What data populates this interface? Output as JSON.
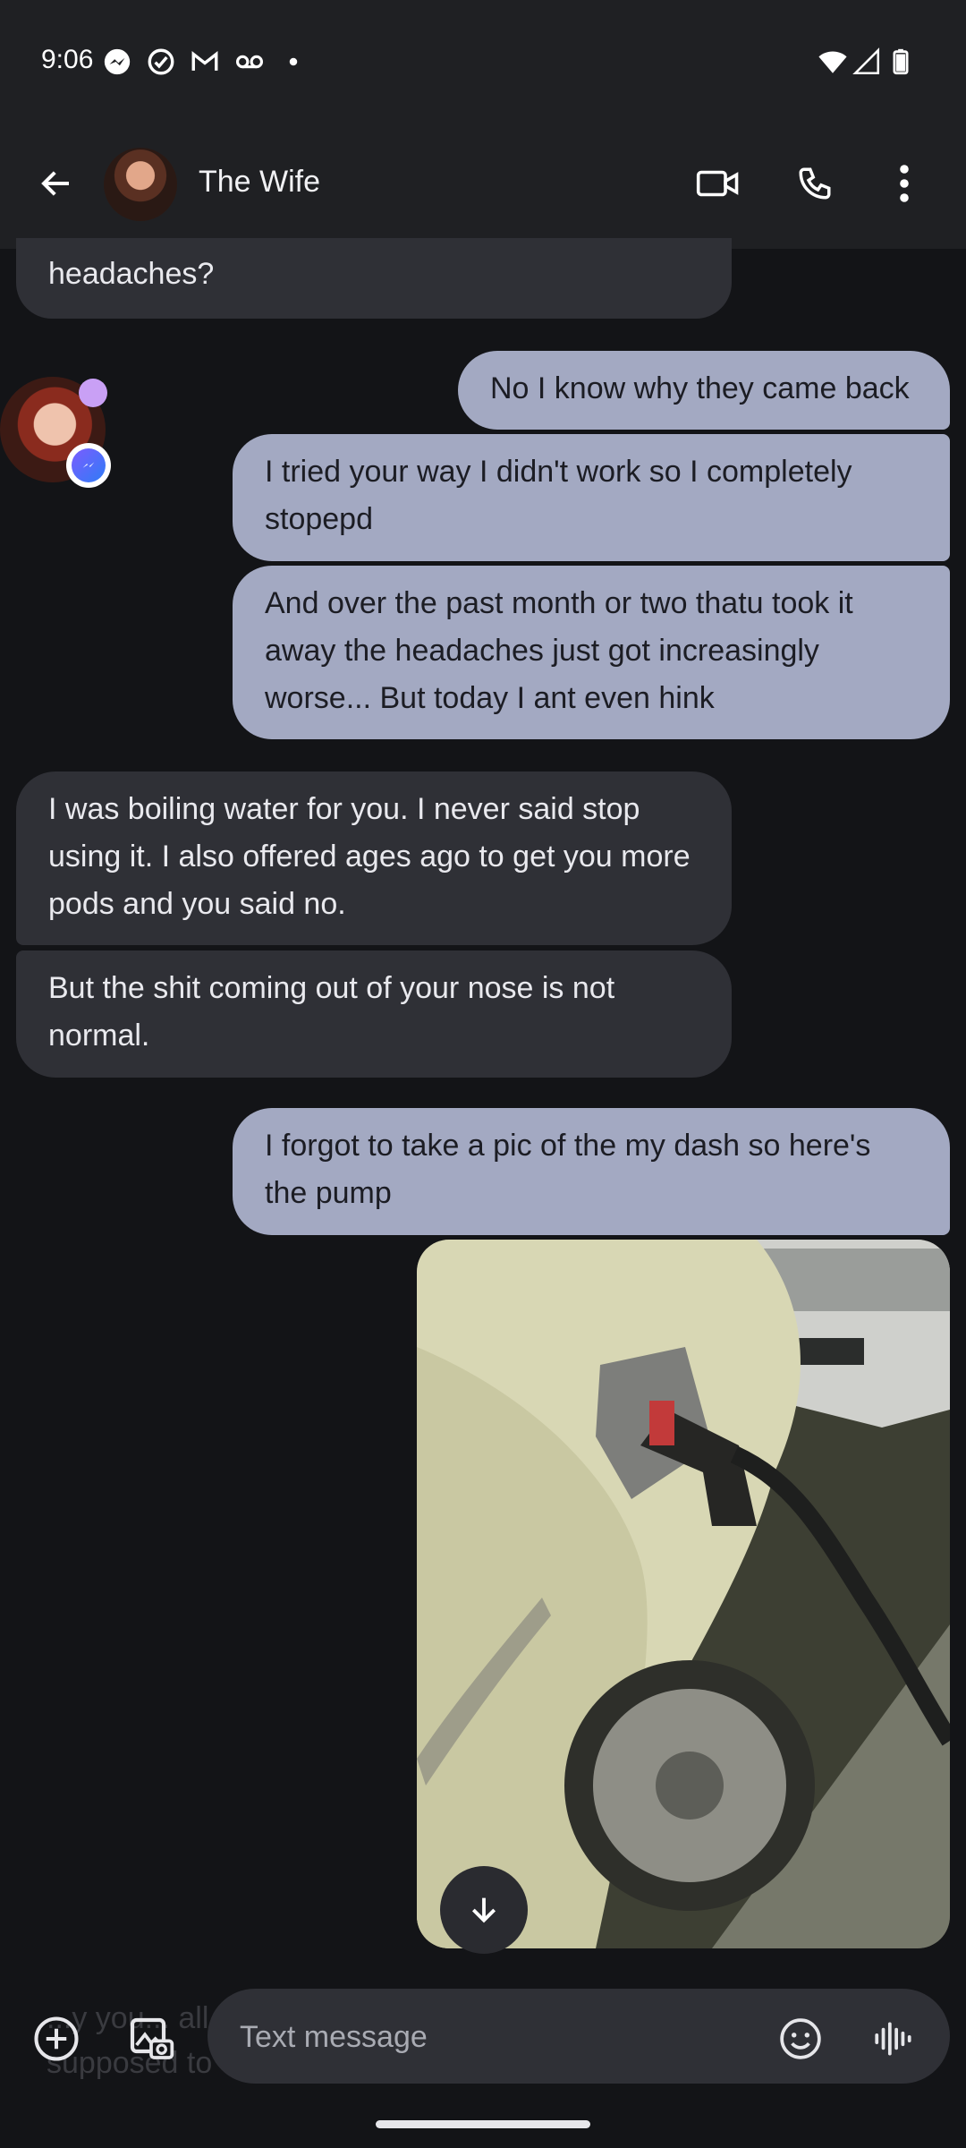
{
  "status_bar": {
    "time": "9:06",
    "icons": [
      "messenger-icon",
      "check-circle-icon",
      "gmail-icon",
      "voicemail-icon",
      "dot-icon",
      "wifi-icon",
      "signal-icon",
      "battery-icon"
    ]
  },
  "header": {
    "contact_name": "The Wife",
    "icons": [
      "back-arrow-icon",
      "video-call-icon",
      "phone-icon",
      "more-vert-icon"
    ]
  },
  "messages": [
    {
      "direction": "incoming",
      "text": "headaches?"
    },
    {
      "direction": "outgoing",
      "text": "No I know why they came back"
    },
    {
      "direction": "outgoing",
      "text": "I tried your way I didn't work so I completely stopepd"
    },
    {
      "direction": "outgoing",
      "text": "And over the past month or two thatu took it away the headaches just got increasingly worse... But today I ant even hink"
    },
    {
      "direction": "incoming",
      "text": "I was boiling water for you. I never said stop using it. I also offered ages ago to get you more pods and you said no."
    },
    {
      "direction": "incoming",
      "text": "But the shit coming out of your nose is not normal."
    },
    {
      "direction": "outgoing",
      "text": "I forgot to take a pic of the my dash so here's the pump"
    }
  ],
  "attachment": {
    "type": "photo",
    "download_icon": "arrow-down-icon"
  },
  "compose": {
    "placeholder": "Text message",
    "value": "",
    "ghost_text": "...y you... all... wasn't wrong... gas. What am I supposed to do, somehow",
    "icons": [
      "add-circle-icon",
      "gallery-icon",
      "emoji-icon",
      "voice-waveform-icon"
    ]
  },
  "colors": {
    "background": "#131417",
    "bar": "#1f2023",
    "incoming_bubble": "#2f3036",
    "outgoing_bubble": "#a3a9c2",
    "presence": "#c9a0f5"
  }
}
